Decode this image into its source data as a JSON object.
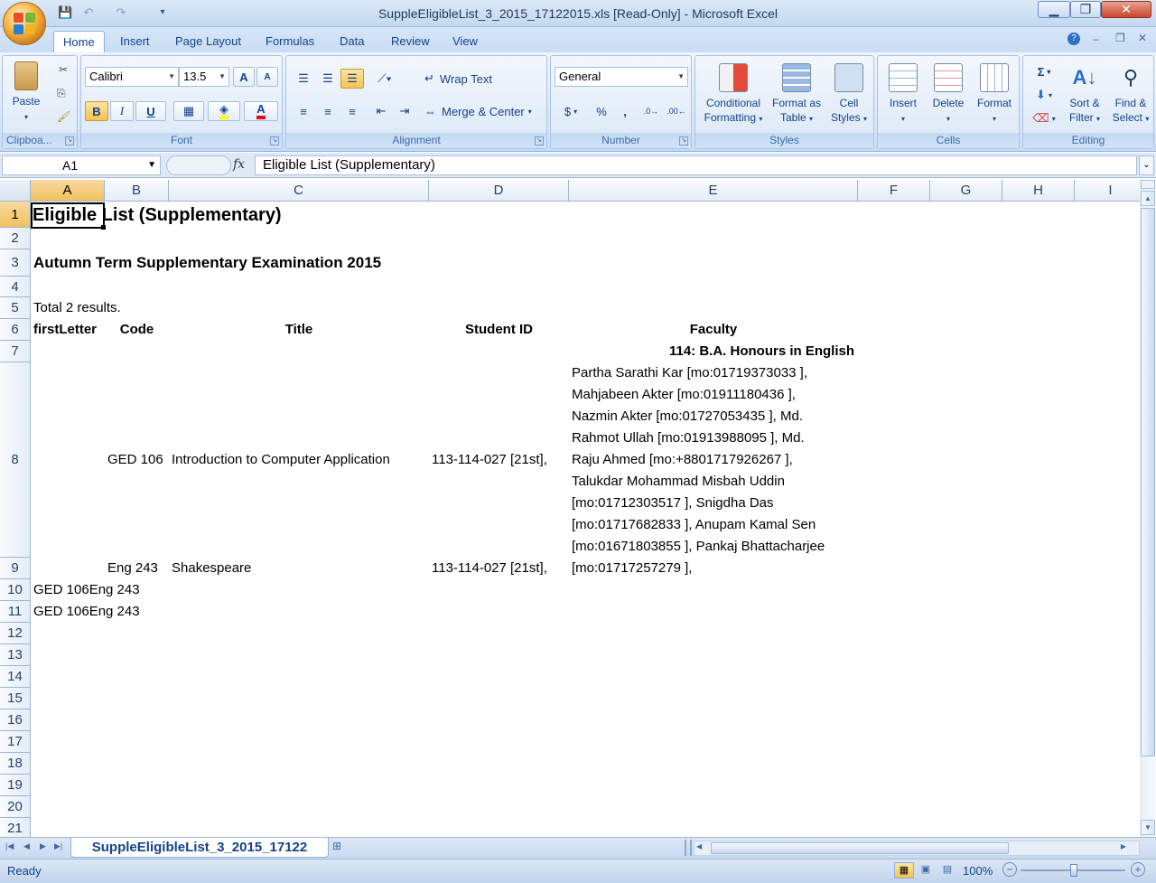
{
  "window": {
    "title": "SuppleEligibleList_3_2015_17122015.xls  [Read-Only] - Microsoft Excel",
    "minimize": "▁",
    "restore": "❐",
    "close": "✕"
  },
  "ribbon": {
    "tabs": [
      "Home",
      "Insert",
      "Page Layout",
      "Formulas",
      "Data",
      "Review",
      "View"
    ],
    "active_tab": "Home",
    "clipboard": {
      "paste": "Paste",
      "label": "Clipboa..."
    },
    "font": {
      "name": "Calibri",
      "size": "13.5",
      "bold": "B",
      "italic": "I",
      "underline": "U",
      "grow": "A",
      "shrink": "A",
      "label": "Font"
    },
    "alignment": {
      "wrap_text": "Wrap Text",
      "merge_center": "Merge & Center",
      "label": "Alignment"
    },
    "number": {
      "format": "General",
      "currency": "$",
      "percent": "%",
      "comma": ",",
      "label": "Number"
    },
    "styles": {
      "conditional": "Conditional",
      "conditional2": "Formatting",
      "format_as": "Format as",
      "format_as2": "Table",
      "cell": "Cell",
      "cell2": "Styles",
      "label": "Styles"
    },
    "cells": {
      "insert": "Insert",
      "delete": "Delete",
      "format": "Format",
      "label": "Cells"
    },
    "editing": {
      "sigma": "Σ",
      "sort": "Sort &",
      "sort2": "Filter",
      "find": "Find &",
      "find2": "Select",
      "label": "Editing"
    }
  },
  "formula_bar": {
    "name_box": "A1",
    "fx": "fx",
    "content": "Eligible List (Supplementary)"
  },
  "columns": [
    "A",
    "B",
    "C",
    "D",
    "E",
    "F",
    "G",
    "H",
    "I"
  ],
  "rows": [
    "1",
    "2",
    "3",
    "4",
    "5",
    "6",
    "7",
    "8",
    "9",
    "10",
    "11",
    "12",
    "13",
    "14",
    "15",
    "16",
    "17",
    "18",
    "19",
    "20",
    "21"
  ],
  "cells": {
    "a1": "Eligible List (Supplementary)",
    "a3": "Autumn Term Supplementary Examination 2015",
    "a5": "Total 2 results.",
    "a6": "firstLetter",
    "b6": "Code",
    "c6": "Title",
    "d6": "Student ID",
    "e6": "Faculty",
    "e7": "114: B.A. Honours in English",
    "e8_lines": [
      "Partha Sarathi Kar [mo:01719373033 ],",
      "Mahjabeen Akter [mo:01911180436 ],",
      "Nazmin Akter [mo:01727053435 ], Md.",
      "Rahmot Ullah [mo:01913988095 ], Md.",
      "Raju Ahmed [mo:+8801717926267 ],",
      "Talukdar Mohammad Misbah Uddin",
      "[mo:01712303517 ], Snigdha Das",
      "[mo:01717682833 ], Anupam Kamal Sen",
      "[mo:01671803855 ], Pankaj Bhattacharjee",
      "[mo:01717257279 ],"
    ],
    "b8": "GED 106",
    "c8": "Introduction to Computer Application",
    "d8": "113-114-027 [21st],",
    "b9": "Eng 243",
    "c9": "Shakespeare",
    "d9": "113-114-027 [21st],",
    "a10": "GED 106Eng 243",
    "a11": "GED 106Eng 243"
  },
  "sheet_tab": "SuppleEligibleList_3_2015_17122",
  "status": {
    "ready": "Ready",
    "zoom": "100%"
  }
}
